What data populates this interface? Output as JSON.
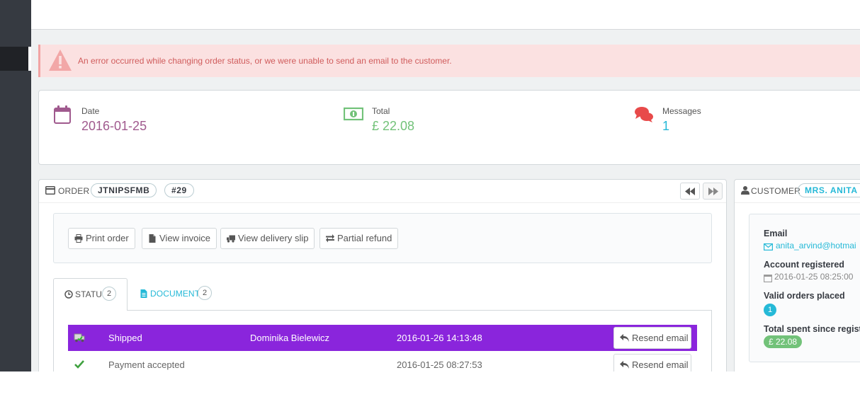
{
  "alert": {
    "message": "An error occurred while changing order status, or we were unable to send an email to the customer."
  },
  "kpis": {
    "date": {
      "label": "Date",
      "value": "2016-01-25",
      "color": "#a05a8e"
    },
    "total": {
      "label": "Total",
      "value": "£ 22.08",
      "color": "#72c279"
    },
    "messages": {
      "label": "Messages",
      "value": "1",
      "color": "#25b9d7"
    }
  },
  "order": {
    "heading": "ORDER",
    "reference": "JTNIPSFMB",
    "number": "#29",
    "actions": {
      "print": "Print order",
      "invoice": "View invoice",
      "delivery": "View delivery slip",
      "refund": "Partial refund"
    },
    "tabs": {
      "status": {
        "label": "STATUS",
        "count": "2"
      },
      "documents": {
        "label": "DOCUMENTS",
        "count": "2"
      }
    },
    "history": [
      {
        "status": "Shipped",
        "employee": "Dominika Bielewicz",
        "date": "2016-01-26 14:13:48",
        "action": "Resend email",
        "color": "#8a25dc"
      },
      {
        "status": "Payment accepted",
        "employee": "",
        "date": "2016-01-25 08:27:53",
        "action": "Resend email"
      }
    ]
  },
  "customer": {
    "heading": "CUSTOMER",
    "name": "MRS. ANITA RA",
    "email_label": "Email",
    "email": "anita_arvind@hotmai",
    "registered_label": "Account registered",
    "registered": "2016-01-25 08:25:00",
    "orders_label": "Valid orders placed",
    "orders": "1",
    "spent_label": "Total spent since regist",
    "spent": "£ 22.08"
  }
}
